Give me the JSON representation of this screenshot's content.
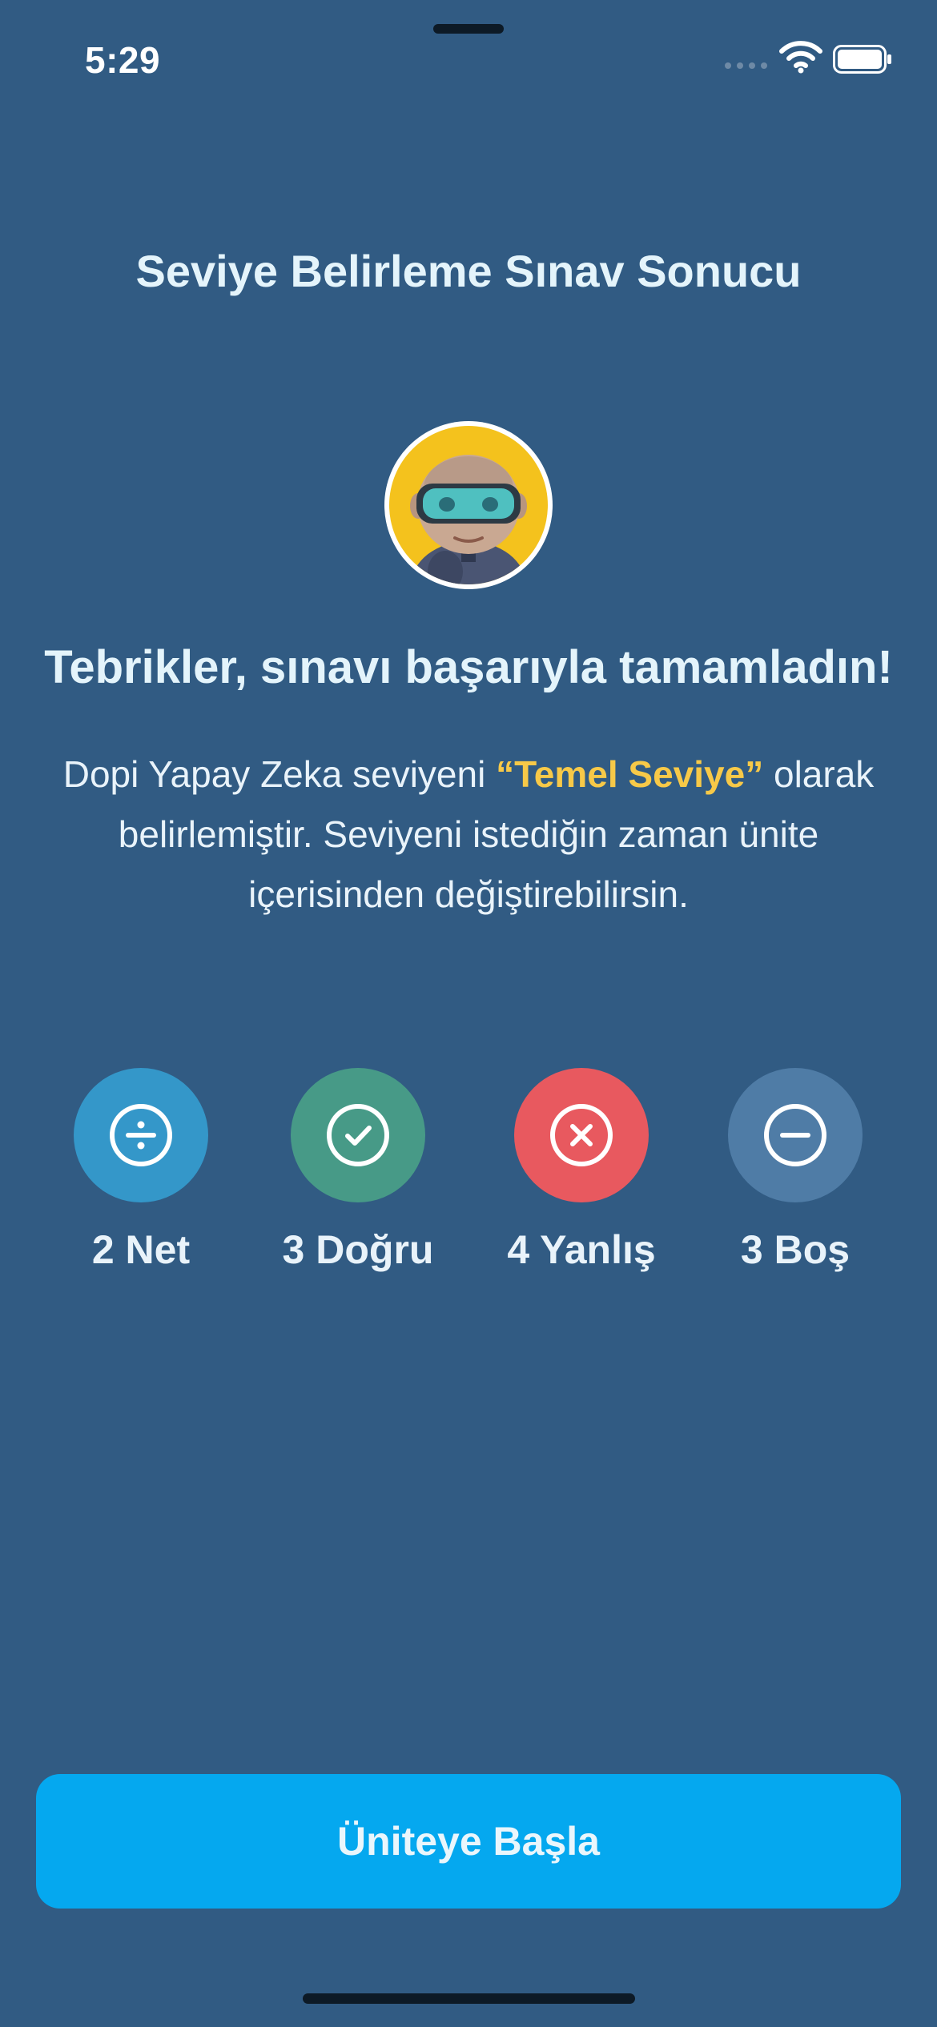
{
  "status_bar": {
    "time": "5:29"
  },
  "title": "Seviye Belirleme Sınav Sonucu",
  "headline": "Tebrikler, sınavı başarıyla tamamladın!",
  "description": {
    "before": "Dopi Yapay Zeka seviyeni ",
    "level": "“Temel Seviye”",
    "after": " olarak belirlemiştir. Seviyeni istediğin zaman ünite içerisinden değiştirebilirsin."
  },
  "stats": [
    {
      "label": "2 Net",
      "icon": "divide-icon",
      "color": "#3497c9"
    },
    {
      "label": "3 Doğru",
      "icon": "check-icon",
      "color": "#479a87"
    },
    {
      "label": "4 Yanlış",
      "icon": "x-icon",
      "color": "#e8595f"
    },
    {
      "label": "3 Boş",
      "icon": "minus-icon",
      "color": "#4f7ca6"
    }
  ],
  "button": {
    "label": "Üniteye Başla",
    "color": "#05a8ef"
  },
  "colors": {
    "background": "#315b83",
    "highlight": "#f7c948"
  }
}
